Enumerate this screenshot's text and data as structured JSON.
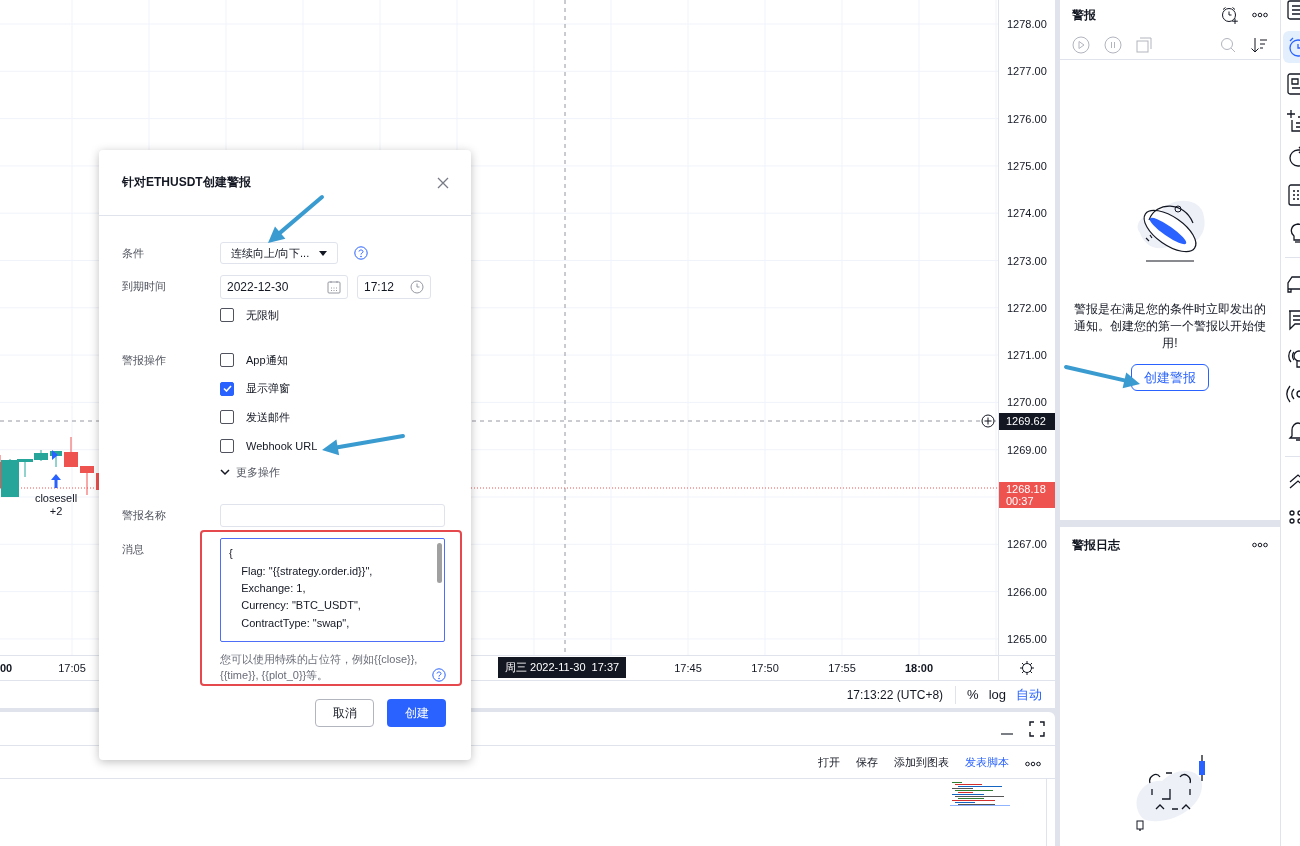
{
  "chart": {
    "price_labels": [
      "1278.00",
      "1277.00",
      "1276.00",
      "1275.00",
      "1274.00",
      "1273.00",
      "1272.00",
      "1271.00",
      "1270.00",
      "1269.00",
      "1267.00",
      "1266.00",
      "1265.00"
    ],
    "crosshair_price": "1269.62",
    "last_price": "1268.18",
    "countdown": "00:37",
    "time_labels": [
      {
        "text": "00",
        "bold": true
      },
      {
        "text": "17:05",
        "bold": false
      },
      {
        "text": "17:45",
        "bold": false
      },
      {
        "text": "17:50",
        "bold": false
      },
      {
        "text": "17:55",
        "bold": false
      },
      {
        "text": "18:00",
        "bold": true
      }
    ],
    "crosshair_time": "周三 2022-11-30  17:37",
    "trade_marker": {
      "label": "closesell",
      "count": "+2"
    }
  },
  "status_bar": {
    "clock": "17:13:22 (UTC+8)",
    "scale_buttons": [
      {
        "label": "%",
        "selected": false
      },
      {
        "label": "log",
        "selected": false
      },
      {
        "label": "自动",
        "selected": true
      }
    ]
  },
  "editor": {
    "actions": [
      {
        "label": "打开",
        "kind": "plain"
      },
      {
        "label": "保存",
        "kind": "plain"
      },
      {
        "label": "添加到图表",
        "kind": "plain"
      },
      {
        "label": "发表脚本",
        "kind": "primary"
      }
    ]
  },
  "alerts_panel": {
    "title": "警报",
    "empty_message": "警报是在满足您的条件时立即发出的通知。创建您的第一个警报以开始使用!",
    "create_button": "创建警报"
  },
  "alert_log": {
    "title": "警报日志"
  },
  "icon_bar": {
    "items": [
      {
        "selected": false
      },
      {
        "selected": true
      },
      {
        "selected": false
      },
      {
        "selected": false
      },
      {
        "selected": false
      },
      {
        "selected": false
      },
      {
        "selected": false
      },
      {
        "selected": false
      },
      {
        "selected": false
      },
      {
        "selected": false
      },
      {
        "selected": false
      },
      {
        "selected": false
      },
      {
        "selected": false
      },
      {
        "selected": false
      }
    ]
  },
  "dialog": {
    "title": "针对ETHUSDT创建警报",
    "condition": {
      "label": "条件",
      "value": "连续向上/向下..."
    },
    "expiry": {
      "label": "到期时间",
      "date": "2022-12-30",
      "time": "17:12"
    },
    "unlimited": {
      "label": "无限制",
      "checked": false
    },
    "alert_actions": {
      "label": "警报操作",
      "options": [
        {
          "label": "App通知",
          "checked": false
        },
        {
          "label": "显示弹窗",
          "checked": true
        },
        {
          "label": "发送邮件",
          "checked": false
        },
        {
          "label": "Webhook URL",
          "checked": false
        }
      ],
      "more": "更多操作"
    },
    "alert_name": {
      "label": "警报名称"
    },
    "message": {
      "label": "消息",
      "value": "{\n    Flag: \"{{strategy.order.id}}\",\n    Exchange: 1,\n    Currency: \"BTC_USDT\",\n    ContractType: \"swap\","
    },
    "hint": "您可以使用特殊的占位符，例如{{close}}, {{time}}, {{plot_0}}等。",
    "cancel_button": "取消",
    "create_button": "创建"
  }
}
